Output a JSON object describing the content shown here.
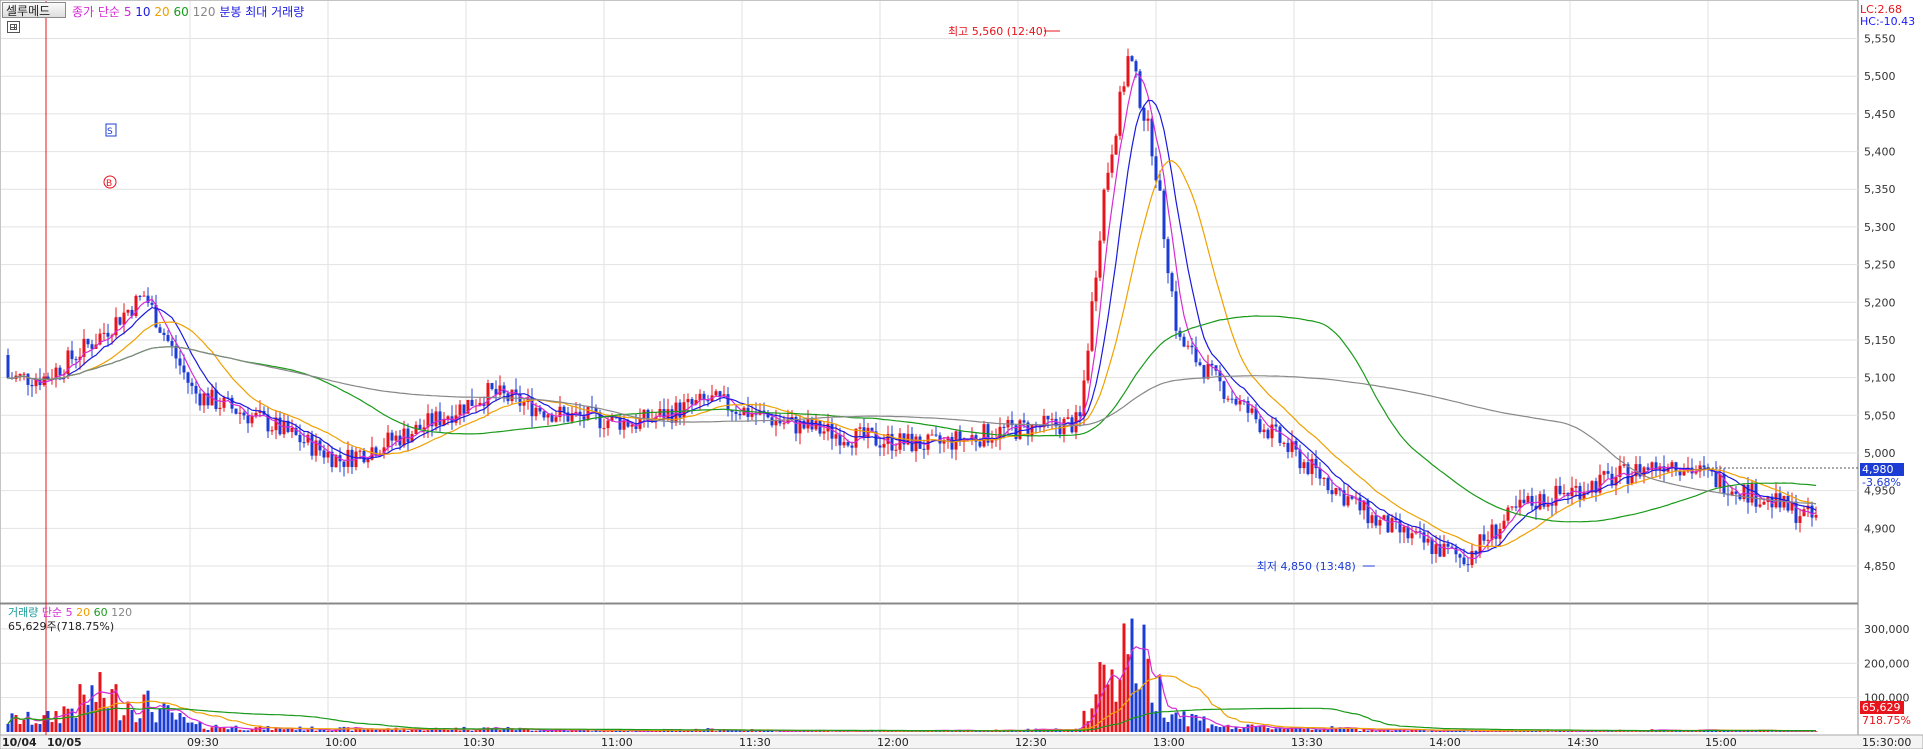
{
  "header": {
    "stock_name": "셀루메드",
    "ma_legend": {
      "prefix": "종가 단순",
      "p5": "5",
      "p10": "10",
      "p20": "20",
      "p60": "60",
      "p120": "120"
    },
    "max_volume_label": "분봉 최대 거래량"
  },
  "top_right": {
    "lc": "LC:2.68",
    "hc": "HC:-10.43"
  },
  "annotations": {
    "high_label": "최고 5,560 (12:40)",
    "low_label": "최저 4,850 (13:48)",
    "buy_marker": "B",
    "sell_marker": "S"
  },
  "price_axis": [
    "5,550",
    "5,500",
    "5,450",
    "5,400",
    "5,350",
    "5,300",
    "5,250",
    "5,200",
    "5,150",
    "5,100",
    "5,050",
    "5,000",
    "4,950",
    "4,900",
    "4,850"
  ],
  "current_price": {
    "value": "4,980",
    "change": "-3.68%"
  },
  "volume_legend": {
    "prefix": "거래량",
    "simple": "단순",
    "p5": "5",
    "p20": "20",
    "p60": "60",
    "p120": "120",
    "current": "65,629주(718.75%)"
  },
  "volume_axis": [
    "300,000",
    "200,000",
    "100,000"
  ],
  "volume_tag": {
    "value": "65,629",
    "pct": "718.75%"
  },
  "time_axis": {
    "first_date": "10/04",
    "second_date": "10/05",
    "labels": [
      "09:30",
      "10:00",
      "10:30",
      "11:00",
      "11:30",
      "12:00",
      "12:30",
      "13:00",
      "13:30",
      "14:00",
      "14:30",
      "15:00",
      "15:30:00"
    ]
  },
  "colors": {
    "up": "#e8141c",
    "down": "#1c3cd6",
    "ma5": "#d62bd6",
    "ma10": "#1a1ae0",
    "ma20": "#f0a000",
    "ma60": "#1a9a1a",
    "ma120": "#888888",
    "grid": "#e2e2e2"
  },
  "chart_data": {
    "type": "candlestick",
    "title": "셀루메드",
    "ylim": [
      4820,
      5580
    ],
    "x": [
      "09:00",
      "09:10",
      "09:20",
      "09:30",
      "09:45",
      "10:00",
      "10:15",
      "10:30",
      "10:45",
      "11:00",
      "11:15",
      "11:30",
      "11:45",
      "12:00",
      "12:15",
      "12:30",
      "12:35",
      "12:40",
      "12:45",
      "12:50",
      "13:00",
      "13:15",
      "13:30",
      "13:40",
      "13:48",
      "14:00",
      "14:15",
      "14:30",
      "14:45",
      "15:00",
      "15:10",
      "15:20"
    ],
    "close": [
      5100,
      5150,
      5210,
      5080,
      5040,
      4990,
      5030,
      5080,
      5050,
      5040,
      5070,
      5040,
      5020,
      5010,
      5030,
      5040,
      5350,
      5530,
      5400,
      5150,
      5080,
      4990,
      4910,
      4880,
      4860,
      4930,
      4960,
      4990,
      4950,
      4910,
      4970,
      4980
    ],
    "volume": [
      40000,
      120000,
      90000,
      20000,
      12000,
      10000,
      9000,
      12000,
      6000,
      5000,
      8000,
      4000,
      3000,
      4000,
      6000,
      8000,
      200000,
      320000,
      150000,
      60000,
      15000,
      14000,
      8000,
      6000,
      4000,
      5000,
      4000,
      6000,
      5000,
      4000,
      6000,
      65629
    ],
    "high": {
      "value": 5560,
      "time": "12:40"
    },
    "low": {
      "value": 4850,
      "time": "13:48"
    }
  }
}
